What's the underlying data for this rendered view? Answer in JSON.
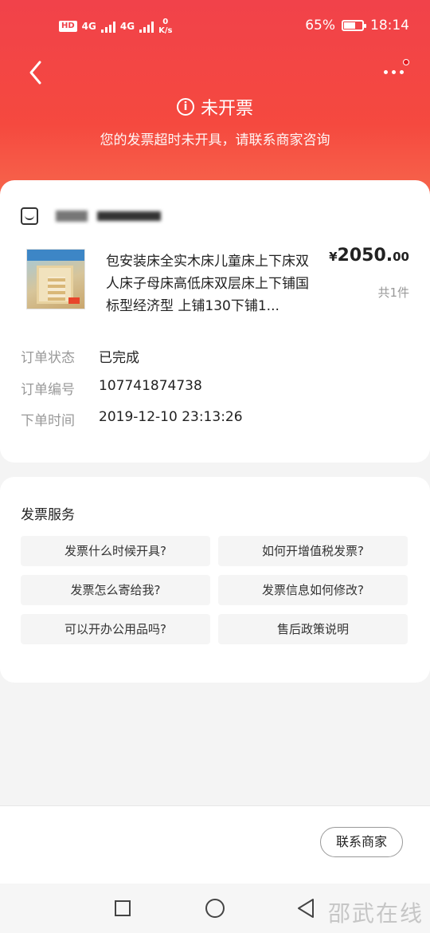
{
  "status_bar": {
    "hd": "HD",
    "net1": "4G",
    "net2": "4G",
    "speed_value": "0",
    "speed_unit": "K/s",
    "battery": "65%",
    "battery_level": 0.65,
    "time": "18:14"
  },
  "header": {
    "title": "未开票",
    "subtitle": "您的发票超时未开具，请联系商家咨询"
  },
  "order": {
    "product_name": "包安装床全实木床儿童床上下床双人床子母床高低床双层床上下铺国标型经济型 上铺130下铺1...",
    "price_currency": "¥",
    "price_int": "2050.",
    "price_dec": "00",
    "quantity": "共1件",
    "status_label": "订单状态",
    "status_value": "已完成",
    "number_label": "订单编号",
    "number_value": "107741874738",
    "time_label": "下单时间",
    "time_value": "2019-12-10 23:13:26"
  },
  "invoice_service": {
    "title": "发票服务",
    "faqs": [
      "发票什么时候开具?",
      "如何开增值税发票?",
      "发票怎么寄给我?",
      "发票信息如何修改?",
      "可以开办公用品吗?",
      "售后政策说明"
    ]
  },
  "bottom": {
    "contact_label": "联系商家"
  },
  "watermark": "邵武在线",
  "colors": {
    "header_red": "#f1424a",
    "badge_red": "#e1181d"
  }
}
